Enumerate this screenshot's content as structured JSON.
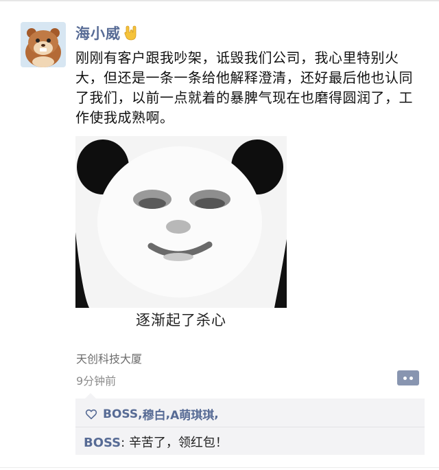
{
  "post": {
    "username": "海小威",
    "text": "刚刚有客户跟我吵架，诋毁我们公司，我心里特别火大，但还是一条一条给他解释澄清，还好最后他也认同了我们，以前一点就着的暴脾气现在也磨得圆润了，工作使我成熟啊。",
    "image_caption": "逐渐起了杀心",
    "location": "天创科技大厦",
    "time": "9分钟前"
  },
  "likes": {
    "names": [
      "BOSS",
      "穆白",
      "A萌琪琪"
    ],
    "sep1": ", ",
    "sep2": ", ",
    "trail": ","
  },
  "comments": [
    {
      "author": "BOSS",
      "sep": ": ",
      "text": "辛苦了，领红包！"
    }
  ],
  "icons": {
    "avatar": "hamster-avatar",
    "hand": "rock-hand-emoji",
    "heart": "heart-outline-icon",
    "comment": "comment-dots-icon"
  },
  "colors": {
    "name_blue": "#576b95",
    "comment_bg": "#f3f3f5"
  }
}
